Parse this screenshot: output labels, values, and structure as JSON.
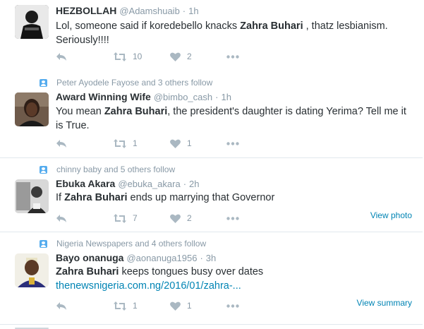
{
  "tweets": [
    {
      "context": "",
      "fullname": "HEZBOLLAH",
      "username": "@Adamshuaib",
      "time": "1h",
      "text_parts": [
        "Lol, someone said if koredebello knacks ",
        "Zahra Buhari",
        " , thatz lesbianism. Seriously!!!!"
      ],
      "retweets": "10",
      "likes": "2",
      "side_link": ""
    },
    {
      "context": "Peter Ayodele Fayose and 3 others follow",
      "fullname": "Award Winning Wife",
      "username": "@bimbo_cash",
      "time": "1h",
      "text_parts": [
        "You mean ",
        "Zahra Buhari",
        ", the  president's daughter is dating Yerima? Tell me it is True."
      ],
      "retweets": "1",
      "likes": "1",
      "side_link": ""
    },
    {
      "context": "chinny baby and 5 others follow",
      "fullname": "Ebuka Akara",
      "username": "@ebuka_akara",
      "time": "2h",
      "text_parts": [
        "If ",
        "Zahra Buhari",
        " ends up marrying that Governor"
      ],
      "retweets": "7",
      "likes": "2",
      "side_link": "View photo"
    },
    {
      "context": "Nigeria Newspapers and 4 others follow",
      "fullname": "Bayo onanuga",
      "username": "@aonanuga1956",
      "time": "3h",
      "text_parts": [
        "Zahra Buhari",
        " keeps tongues busy over dates ",
        "thenewsnigeria.com.ng/2016/01/zahra-..."
      ],
      "retweets": "1",
      "likes": "1",
      "side_link": "View summary"
    }
  ],
  "dot": "·",
  "icons": {
    "reply": "reply-icon",
    "retweet": "retweet-icon",
    "like": "heart-icon",
    "more": "more-icon",
    "context": "person-follow-icon"
  },
  "colors": {
    "text": "#292f33",
    "muted": "#8899a6",
    "icon": "#aab8c2",
    "link": "#0084b4",
    "border": "#e1e8ed",
    "context_icon": "#55acee"
  }
}
